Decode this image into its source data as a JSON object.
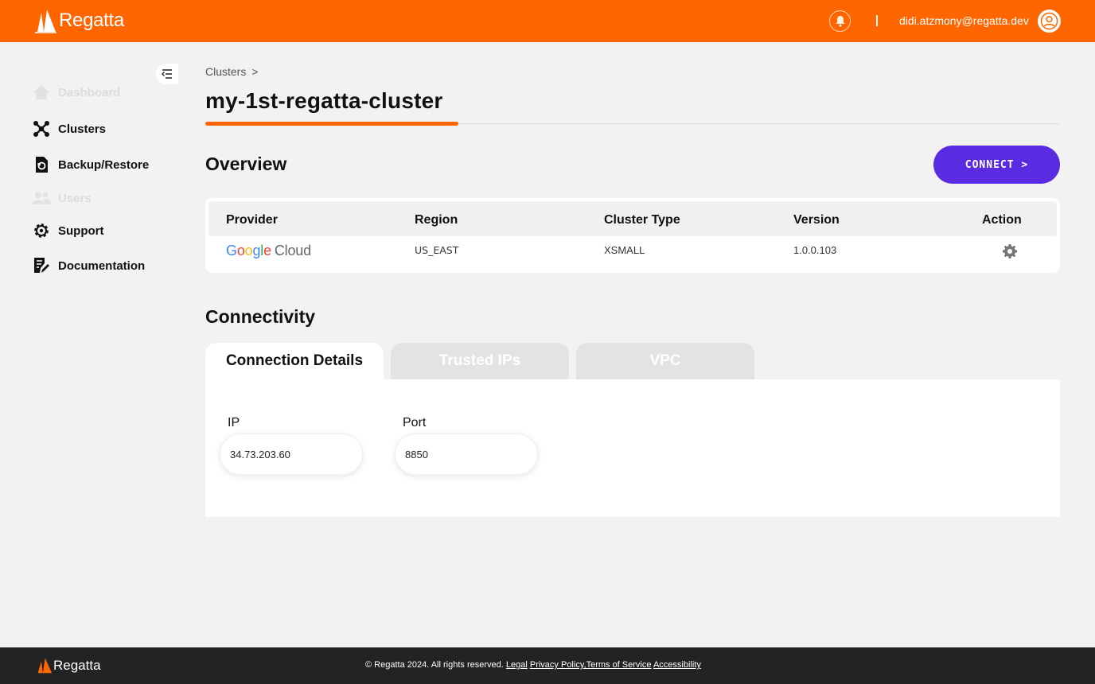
{
  "app": {
    "name": "Regatta"
  },
  "header": {
    "user_email": "didi.atzmony@regatta.dev"
  },
  "sidebar": {
    "items": [
      {
        "label": "Dashboard",
        "icon": "home-icon",
        "disabled": true
      },
      {
        "label": "Clusters",
        "icon": "clusters-icon",
        "disabled": false
      },
      {
        "label": "Backup/Restore",
        "icon": "backup-icon",
        "disabled": false
      },
      {
        "label": "Users",
        "icon": "users-icon",
        "disabled": true
      },
      {
        "label": "Support",
        "icon": "support-gear-icon",
        "disabled": false
      },
      {
        "label": "Documentation",
        "icon": "documentation-icon",
        "disabled": false
      }
    ]
  },
  "breadcrumb": {
    "label": "Clusters",
    "separator": ">"
  },
  "page": {
    "title": "my-1st-regatta-cluster"
  },
  "overview": {
    "title": "Overview",
    "connect_label": "CONNECT >",
    "columns": [
      "Provider",
      "Region",
      "Cluster Type",
      "Version",
      "Action"
    ],
    "row": {
      "provider": {
        "google": "Google",
        "cloud": "Cloud"
      },
      "region": "US_EAST",
      "cluster_type": "XSMALL",
      "version": "1.0.0.103"
    }
  },
  "connectivity": {
    "title": "Connectivity",
    "tabs": [
      "Connection Details",
      "Trusted IPs",
      "VPC"
    ],
    "active_tab": "Connection Details",
    "fields": {
      "ip": {
        "label": "IP",
        "value": "34.73.203.60"
      },
      "port": {
        "label": "Port",
        "value": "8850"
      }
    }
  },
  "footer": {
    "copyright": "© Regatta 2024. All rights reserved.",
    "links": [
      "Legal",
      "Privacy Policy",
      ",Terms of Service",
      "Accessibility"
    ]
  },
  "colors": {
    "brand": "#ff6600",
    "accent": "#5a2be0",
    "footer_bg": "#222325"
  }
}
